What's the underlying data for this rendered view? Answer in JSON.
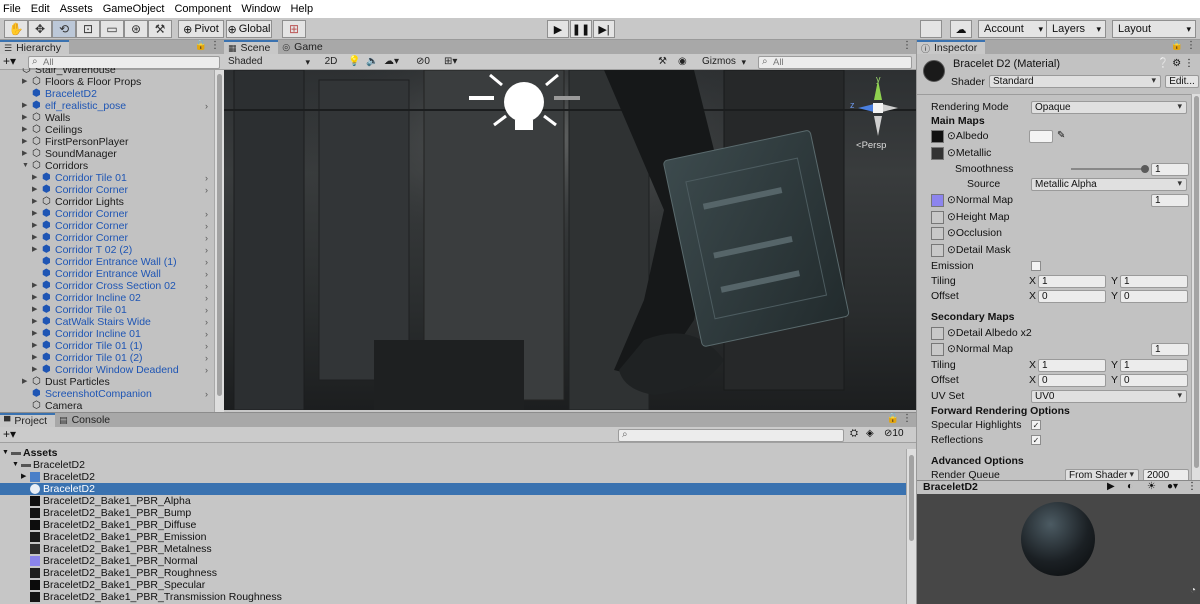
{
  "menu": [
    "File",
    "Edit",
    "Assets",
    "GameObject",
    "Component",
    "Window",
    "Help"
  ],
  "toolbar": {
    "pivot_label": "Pivot",
    "global_label": "Global",
    "account_label": "Account",
    "layers_label": "Layers",
    "layout_label": "Layout"
  },
  "hierarchy": {
    "tab_label": "Hierarchy",
    "search_placeholder": "All",
    "items": [
      {
        "label": "Stair_Warehouse",
        "indent": 1,
        "arrow": "",
        "color": "gray",
        "chevron": false
      },
      {
        "label": "Floors & Floor Props",
        "indent": 2,
        "arrow": "▶",
        "color": "gray",
        "chevron": false
      },
      {
        "label": "BraceletD2",
        "indent": 2,
        "arrow": "",
        "color": "blue",
        "chevron": false
      },
      {
        "label": "elf_realistic_pose",
        "indent": 2,
        "arrow": "▶",
        "color": "blue",
        "chevron": true
      },
      {
        "label": "Walls",
        "indent": 2,
        "arrow": "▶",
        "color": "gray",
        "chevron": false
      },
      {
        "label": "Ceilings",
        "indent": 2,
        "arrow": "▶",
        "color": "gray",
        "chevron": false
      },
      {
        "label": "FirstPersonPlayer",
        "indent": 2,
        "arrow": "▶",
        "color": "gray",
        "chevron": false
      },
      {
        "label": "SoundManager",
        "indent": 2,
        "arrow": "▶",
        "color": "gray",
        "chevron": false
      },
      {
        "label": "Corridors",
        "indent": 2,
        "arrow": "▼",
        "color": "gray",
        "chevron": false
      },
      {
        "label": "Corridor Tile 01",
        "indent": 3,
        "arrow": "▶",
        "color": "blue",
        "chevron": true
      },
      {
        "label": "Corridor Corner",
        "indent": 3,
        "arrow": "▶",
        "color": "blue",
        "chevron": true
      },
      {
        "label": "Corridor Lights",
        "indent": 3,
        "arrow": "▶",
        "color": "gray",
        "chevron": false
      },
      {
        "label": "Corridor Corner",
        "indent": 3,
        "arrow": "▶",
        "color": "blue",
        "chevron": true
      },
      {
        "label": "Corridor Corner",
        "indent": 3,
        "arrow": "▶",
        "color": "blue",
        "chevron": true
      },
      {
        "label": "Corridor Corner",
        "indent": 3,
        "arrow": "▶",
        "color": "blue",
        "chevron": true
      },
      {
        "label": "Corridor T 02 (2)",
        "indent": 3,
        "arrow": "▶",
        "color": "blue",
        "chevron": true
      },
      {
        "label": "Corridor Entrance Wall (1)",
        "indent": 3,
        "arrow": "",
        "color": "blue",
        "chevron": true
      },
      {
        "label": "Corridor Entrance Wall",
        "indent": 3,
        "arrow": "",
        "color": "blue",
        "chevron": true
      },
      {
        "label": "Corridor Cross Section 02",
        "indent": 3,
        "arrow": "▶",
        "color": "blue",
        "chevron": true
      },
      {
        "label": "Corridor Incline 02",
        "indent": 3,
        "arrow": "▶",
        "color": "blue",
        "chevron": true
      },
      {
        "label": "Corridor Tile 01",
        "indent": 3,
        "arrow": "▶",
        "color": "blue",
        "chevron": true
      },
      {
        "label": "CatWalk Stairs Wide",
        "indent": 3,
        "arrow": "▶",
        "color": "blue",
        "chevron": true
      },
      {
        "label": "Corridor Incline 01",
        "indent": 3,
        "arrow": "▶",
        "color": "blue",
        "chevron": true
      },
      {
        "label": "Corridor Tile 01 (1)",
        "indent": 3,
        "arrow": "▶",
        "color": "blue",
        "chevron": true
      },
      {
        "label": "Corridor Tile 01 (2)",
        "indent": 3,
        "arrow": "▶",
        "color": "blue",
        "chevron": true
      },
      {
        "label": "Corridor Window Deadend",
        "indent": 3,
        "arrow": "▶",
        "color": "blue",
        "chevron": true
      },
      {
        "label": "Dust Particles",
        "indent": 2,
        "arrow": "▶",
        "color": "gray",
        "chevron": false
      },
      {
        "label": "ScreenshotCompanion",
        "indent": 2,
        "arrow": "",
        "color": "blue",
        "chevron": true
      },
      {
        "label": "Camera",
        "indent": 2,
        "arrow": "",
        "color": "gray",
        "chevron": false
      }
    ]
  },
  "scene": {
    "tab_scene": "Scene",
    "tab_game": "Game",
    "shading_mode": "Shaded",
    "mode_2d": "2D",
    "hidden_count": "0",
    "gizmos_label": "Gizmos",
    "search_placeholder": "All",
    "projection_label": "Persp",
    "axis_y": "y",
    "axis_z": "z"
  },
  "inspector": {
    "tab_label": "Inspector",
    "material_name": "Bracelet D2 (Material)",
    "shader_label": "Shader",
    "shader_value": "Standard",
    "edit_button": "Edit...",
    "rendering_mode_label": "Rendering Mode",
    "rendering_mode_value": "Opaque",
    "main_maps_header": "Main Maps",
    "albedo_label": "Albedo",
    "metallic_label": "Metallic",
    "smoothness_label": "Smoothness",
    "smoothness_value": "1",
    "smoothness_level": 1.0,
    "source_label": "Source",
    "source_value": "Metallic Alpha",
    "normal_map_label": "Normal Map",
    "normal_map_value": "1",
    "height_map_label": "Height Map",
    "occlusion_label": "Occlusion",
    "detail_mask_label": "Detail Mask",
    "emission_label": "Emission",
    "tiling_label": "Tiling",
    "offset_label": "Offset",
    "x_label": "X",
    "y_label": "Y",
    "tiling_x": "1",
    "tiling_y": "1",
    "offset_x": "0",
    "offset_y": "0",
    "secondary_maps_header": "Secondary Maps",
    "detail_albedo_label": "Detail Albedo x2",
    "normal_map2_label": "Normal Map",
    "normal_map2_value": "1",
    "tiling2_x": "1",
    "tiling2_y": "1",
    "offset2_x": "0",
    "offset2_y": "0",
    "uv_set_label": "UV Set",
    "uv_set_value": "UV0",
    "forward_header": "Forward Rendering Options",
    "specular_label": "Specular Highlights",
    "reflections_label": "Reflections",
    "advanced_header": "Advanced Options",
    "render_queue_label": "Render Queue",
    "render_queue_mode": "From Shader",
    "render_queue_value": "2000",
    "preview_title": "BraceletD2",
    "colors": {
      "albedo": "#f4f4f4",
      "normal_map": "#8c84ee",
      "metallic": "#333333"
    }
  },
  "project": {
    "tab_project": "Project",
    "tab_console": "Console",
    "hidden_count": "10",
    "tree": [
      {
        "label": "Assets",
        "indent": 0,
        "arrow": "▼",
        "bold": true
      },
      {
        "label": "BraceletD2",
        "indent": 1,
        "arrow": "▼",
        "bold": false
      }
    ],
    "files": [
      {
        "label": "BraceletD2",
        "thumb": "#4a7fc8",
        "arrow": "▶",
        "selected": false
      },
      {
        "label": "BraceletD2",
        "thumb": "#e8eef6",
        "arrow": "",
        "selected": true
      },
      {
        "label": "BraceletD2_Bake1_PBR_Alpha",
        "thumb": "#101010",
        "arrow": "",
        "selected": false
      },
      {
        "label": "BraceletD2_Bake1_PBR_Bump",
        "thumb": "#141414",
        "arrow": "",
        "selected": false
      },
      {
        "label": "BraceletD2_Bake1_PBR_Diffuse",
        "thumb": "#0d0d0d",
        "arrow": "",
        "selected": false
      },
      {
        "label": "BraceletD2_Bake1_PBR_Emission",
        "thumb": "#181818",
        "arrow": "",
        "selected": false
      },
      {
        "label": "BraceletD2_Bake1_PBR_Metalness",
        "thumb": "#2e2e2e",
        "arrow": "",
        "selected": false
      },
      {
        "label": "BraceletD2_Bake1_PBR_Normal",
        "thumb": "#8a84ea",
        "arrow": "",
        "selected": false
      },
      {
        "label": "BraceletD2_Bake1_PBR_Roughness",
        "thumb": "#1e1e1e",
        "arrow": "",
        "selected": false
      },
      {
        "label": "BraceletD2_Bake1_PBR_Specular",
        "thumb": "#0b0b0b",
        "arrow": "",
        "selected": false
      },
      {
        "label": "BraceletD2_Bake1_PBR_Transmission Roughness",
        "thumb": "#141414",
        "arrow": "",
        "selected": false
      }
    ]
  },
  "accent_color": "#3a72b0"
}
